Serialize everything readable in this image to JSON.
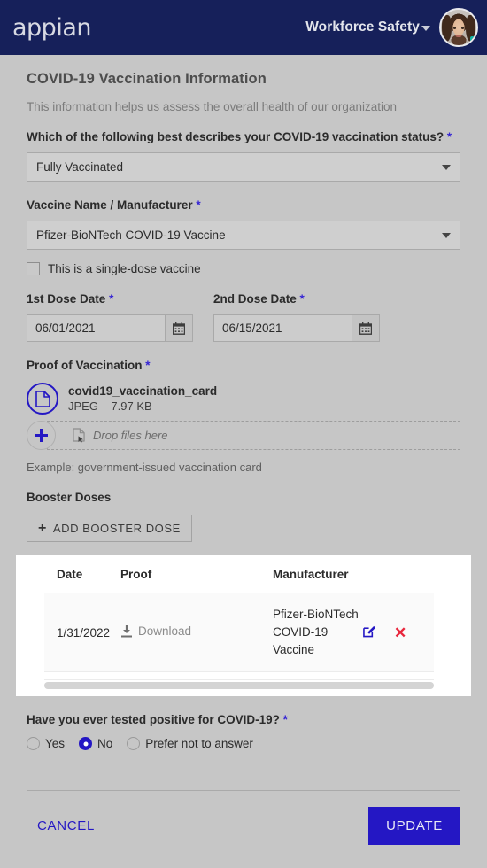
{
  "header": {
    "logo_text": "appian",
    "site_name": "Workforce Safety",
    "caret_icon": "chevron-down-icon",
    "avatar_icon": "user-avatar"
  },
  "form": {
    "title": "COVID-19 Vaccination Information",
    "subtitle": "This information helps us assess the overall health of our organization",
    "status_label": "Which of the following best describes your COVID-19 vaccination status?",
    "status_required": "*",
    "status_value": "Fully Vaccinated",
    "manufacturer_label": "Vaccine Name / Manufacturer",
    "manufacturer_required": "*",
    "manufacturer_value": "Pfizer-BioNTech COVID-19 Vaccine",
    "single_dose_label": "This is a single-dose vaccine",
    "single_dose_checked": false,
    "dose1_label": "1st Dose Date",
    "dose1_required": "*",
    "dose1_value": "06/01/2021",
    "dose2_label": "2nd Dose Date",
    "dose2_required": "*",
    "dose2_value": "06/15/2021",
    "proof_label": "Proof of Vaccination",
    "proof_required": "*",
    "file_name": "covid19_vaccination_card",
    "file_meta": "JPEG – 7.97 KB",
    "drop_text": "Drop files here",
    "example_text": "Example: government-issued vaccination card",
    "booster_heading": "Booster Doses",
    "add_booster_label": "ADD BOOSTER DOSE",
    "add_booster_plus": "+",
    "tested_positive_label": "Have you ever tested positive for COVID-19?",
    "tested_positive_required": "*",
    "tested_positive_options": [
      {
        "label": "Yes",
        "selected": false
      },
      {
        "label": "No",
        "selected": true
      },
      {
        "label": "Prefer not to answer",
        "selected": false
      }
    ]
  },
  "booster_table": {
    "columns": [
      "Date",
      "Proof",
      "Manufacturer",
      ""
    ],
    "rows": [
      {
        "date": "1/31/2022",
        "proof": "Download",
        "manufacturer": "Pfizer-BioNTech COVID-19 Vaccine",
        "edit_icon": "edit-pencil-icon",
        "delete_icon": "delete-x-icon"
      }
    ]
  },
  "footer": {
    "cancel_label": "CANCEL",
    "update_label": "UPDATE"
  },
  "colors": {
    "header_bg": "#16205a",
    "accent": "#2417c4",
    "page_bg": "#c6c6c6",
    "delete_red": "#e8253b"
  }
}
